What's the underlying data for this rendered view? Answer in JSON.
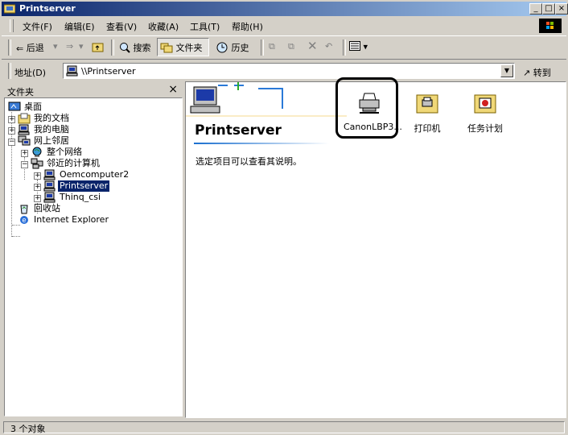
{
  "window": {
    "title": "Printserver"
  },
  "menu": [
    "文件(F)",
    "编辑(E)",
    "查看(V)",
    "收藏(A)",
    "工具(T)",
    "帮助(H)"
  ],
  "toolbar": {
    "back": "后退",
    "search": "搜索",
    "folders": "文件夹",
    "history": "历史"
  },
  "address": {
    "label": "地址(D)",
    "value": "\\\\Printserver",
    "go": "转到"
  },
  "folders_pane": {
    "title": "文件夹",
    "close": "×",
    "tree": [
      {
        "label": "桌面",
        "icon": "desktop-icon"
      },
      {
        "label": "我的文档",
        "icon": "folder-icon"
      },
      {
        "label": "我的电脑",
        "icon": "computer-icon"
      },
      {
        "label": "网上邻居",
        "icon": "network-icon"
      },
      {
        "label": "整个网络",
        "icon": "globe-icon"
      },
      {
        "label": "邻近的计算机",
        "icon": "workgroup-icon"
      },
      {
        "label": "Oemcomputer2",
        "icon": "computer-icon"
      },
      {
        "label": "Printserver",
        "icon": "computer-icon",
        "selected": true
      },
      {
        "label": "Thinq_csi",
        "icon": "computer-icon"
      },
      {
        "label": "回收站",
        "icon": "recycle-bin-icon"
      },
      {
        "label": "Internet Explorer",
        "icon": "ie-icon"
      }
    ]
  },
  "content": {
    "folder_title": "Printserver",
    "description": "选定项目可以查看其说明。",
    "items": [
      {
        "label": "CanonLBP3...",
        "icon": "shared-printer-icon"
      },
      {
        "label": "打印机",
        "icon": "printers-folder-icon"
      },
      {
        "label": "任务计划",
        "icon": "scheduled-tasks-icon"
      }
    ]
  },
  "status": {
    "text": "3 个对象"
  }
}
